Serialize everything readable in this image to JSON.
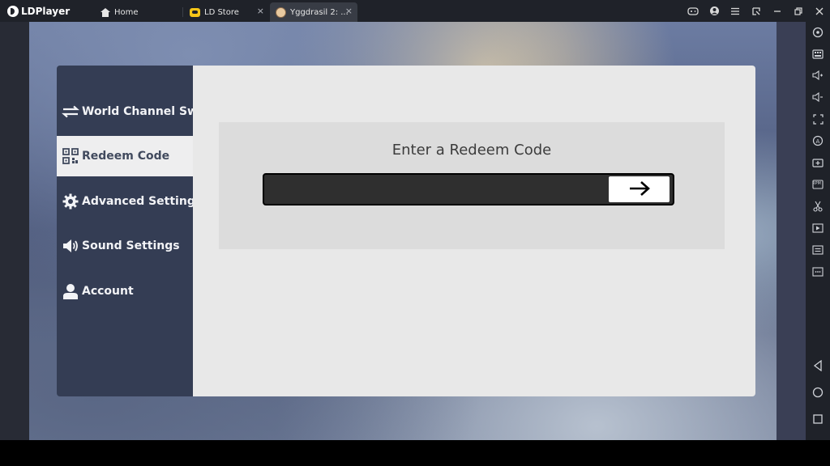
{
  "titlebar": {
    "app_name": "LDPlayer",
    "tabs": [
      {
        "label": "Home",
        "icon": "home-icon"
      },
      {
        "label": "LD Store",
        "icon": "store-icon"
      },
      {
        "label": "Yggdrasil 2: ...",
        "icon": "game-icon",
        "active": true
      }
    ],
    "close_glyph": "×"
  },
  "window_controls": [
    "gamepad-icon",
    "account-icon",
    "menu-icon",
    "resize-icon",
    "minimize-icon",
    "restore-icon",
    "close-icon"
  ],
  "right_toolbar": [
    "settings-icon",
    "keyboard-icon",
    "volume-up-icon",
    "volume-down-icon",
    "fullscreen-icon",
    "rotate-icon",
    "add-apk-icon",
    "rpm-icon",
    "scissors-icon",
    "record-icon",
    "sync-icon",
    "more-icon",
    "back-icon",
    "home-circle-icon",
    "recent-apps-icon"
  ],
  "rpm_label": "RPM",
  "settings": {
    "menu": [
      {
        "label": "World Channel Switch",
        "icon": "swap-arrows-icon"
      },
      {
        "label": "Redeem Code",
        "icon": "qr-code-icon",
        "active": true
      },
      {
        "label": "Advanced Settings",
        "icon": "gear-icon"
      },
      {
        "label": "Sound Settings",
        "icon": "speaker-icon"
      },
      {
        "label": "Account",
        "icon": "person-icon"
      }
    ],
    "redeem": {
      "title": "Enter a Redeem Code",
      "input_value": "",
      "submit_icon": "arrow-right-icon"
    }
  },
  "colors": {
    "titlebar": "#1f2229",
    "sidebar": "#343d54",
    "content": "#e8e8e8",
    "code_bar": "#2f2f2f"
  }
}
